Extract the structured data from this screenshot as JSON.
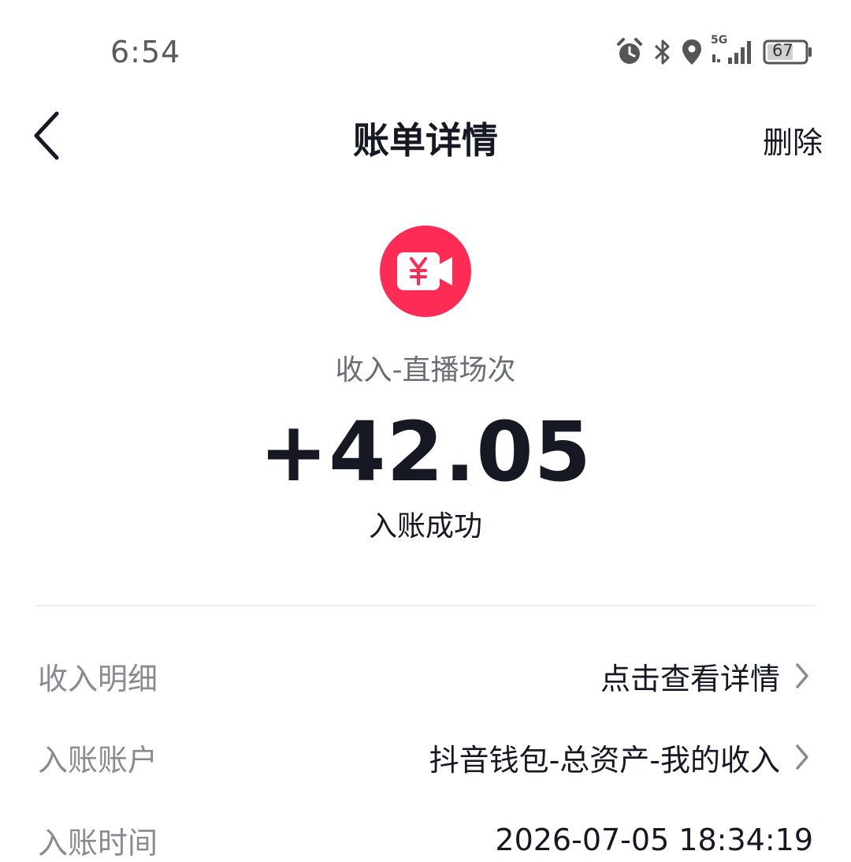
{
  "status_bar": {
    "time": "6:54",
    "network": "5G",
    "battery": "67",
    "icons": [
      "alarm-icon",
      "bluetooth-icon",
      "location-icon",
      "signal-icon",
      "battery-icon"
    ]
  },
  "nav": {
    "title": "账单详情",
    "delete_label": "删除",
    "back_icon": "chevron-left-icon"
  },
  "hero": {
    "icon": "yuan-video-icon",
    "icon_color": "#fe2c55",
    "category": "收入-直播场次",
    "amount": "+42.05",
    "status": "入账成功"
  },
  "details": [
    {
      "label": "收入明细",
      "value": "点击查看详情",
      "has_arrow": true
    },
    {
      "label": "入账账户",
      "value": "抖音钱包-总资产-我的收入",
      "has_arrow": true
    },
    {
      "label": "入账时间",
      "value": "2026-07-05 18:34:19",
      "has_arrow": false
    }
  ]
}
